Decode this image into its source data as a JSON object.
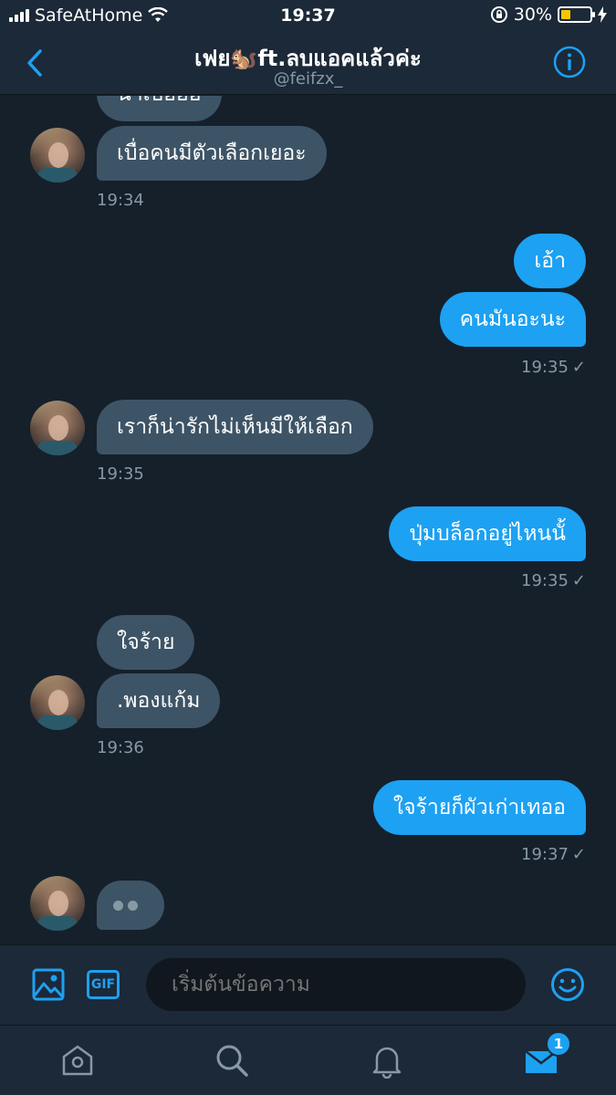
{
  "status_bar": {
    "carrier": "SafeAtHome",
    "time": "19:37",
    "battery": "30%"
  },
  "header": {
    "title": "เฟย🐿️ft.ลบแอคแล้วค่ะ",
    "handle": "@feifzx_"
  },
  "messages": [
    {
      "dir": "in",
      "text": "น่าเบื่ออ่อ"
    },
    {
      "dir": "in",
      "text": "เบื่อคนมีตัวเลือกเยอะ"
    },
    {
      "dir": "out",
      "text": "เอ้า"
    },
    {
      "dir": "out",
      "text": "คนมันอะนะ"
    },
    {
      "dir": "in",
      "text": "เราก็น่ารักไม่เห็นมีให้เลือก"
    },
    {
      "dir": "out",
      "text": "ปุ่มบล็อกอยู่ไหนนั้"
    },
    {
      "dir": "in",
      "text": "ใจร้าย"
    },
    {
      "dir": "in",
      "text": ".พองแก้ม"
    },
    {
      "dir": "out",
      "text": "ใจร้ายก็ผัวเก่าเทออ"
    }
  ],
  "timestamps": [
    "19:34",
    "19:35",
    "19:35",
    "19:35",
    "19:36",
    "19:37"
  ],
  "check_mark": "✓",
  "composer": {
    "placeholder": "เริ่มต้นข้อความ",
    "gif_label": "GIF"
  },
  "tabbar": {
    "messages_badge": "1"
  },
  "colors": {
    "background": "#15202b",
    "header": "#1c2938",
    "accent": "#1da1f2",
    "incoming_bubble": "#3d5466",
    "muted_text": "#8899a6"
  }
}
